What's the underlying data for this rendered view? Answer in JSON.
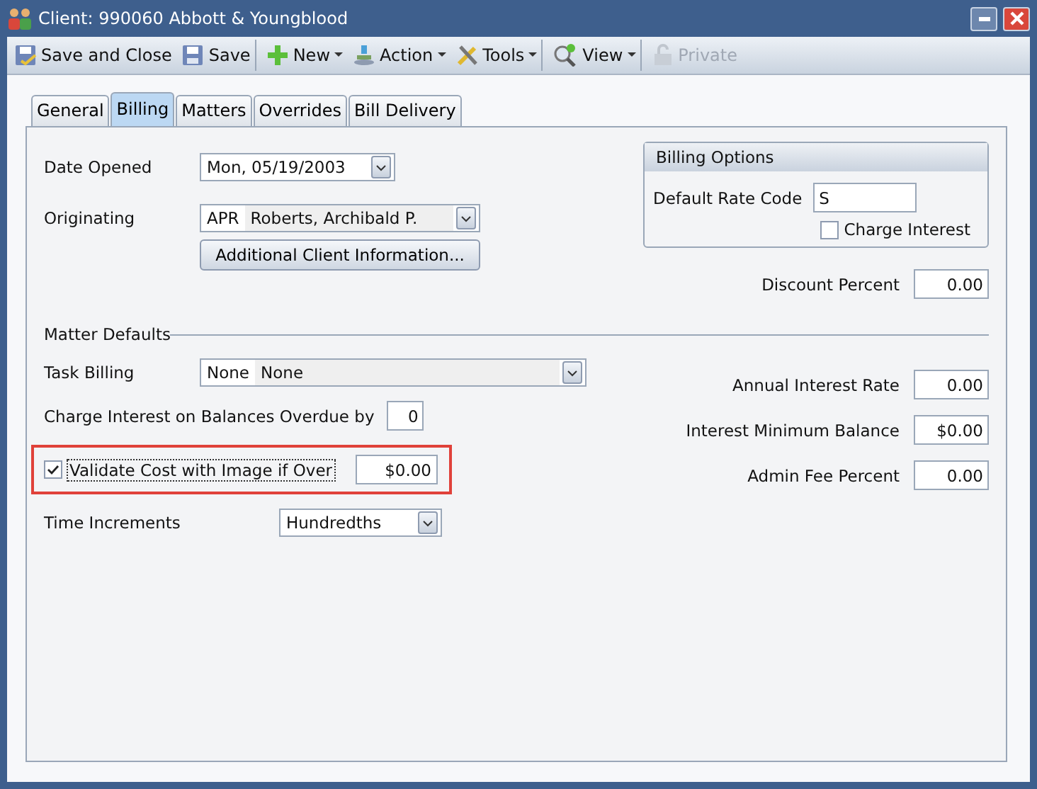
{
  "window": {
    "title": "Client: 990060 Abbott & Youngblood"
  },
  "toolbar": [
    {
      "label": "Save and Close",
      "dropdown": false,
      "disabled": false,
      "separator_after": false
    },
    {
      "label": "Save",
      "dropdown": false,
      "disabled": false,
      "separator_after": true
    },
    {
      "label": "New",
      "dropdown": true,
      "disabled": false,
      "separator_after": false
    },
    {
      "label": "Action",
      "dropdown": true,
      "disabled": false,
      "separator_after": false
    },
    {
      "label": "Tools",
      "dropdown": true,
      "disabled": false,
      "separator_after": true
    },
    {
      "label": "View",
      "dropdown": true,
      "disabled": false,
      "separator_after": true
    },
    {
      "label": "Private",
      "dropdown": false,
      "disabled": true,
      "separator_after": false
    }
  ],
  "tabs": [
    {
      "label": "General",
      "selected": false
    },
    {
      "label": "Billing",
      "selected": true
    },
    {
      "label": "Matters",
      "selected": false
    },
    {
      "label": "Overrides",
      "selected": false
    },
    {
      "label": "Bill Delivery",
      "selected": false
    }
  ],
  "date_opened": {
    "label": "Date Opened",
    "value": "Mon, 05/19/2003"
  },
  "originating": {
    "label": "Originating",
    "code": "APR",
    "name": "Roberts, Archibald P."
  },
  "additional_button": "Additional Client Information...",
  "billing_options": {
    "title": "Billing Options",
    "rate_code_label": "Default Rate Code",
    "rate_code": "S",
    "charge_interest": {
      "label": "Charge Interest",
      "checked": false
    }
  },
  "discount": {
    "label": "Discount Percent",
    "value": "0.00"
  },
  "matter_defaults": {
    "title": "Matter Defaults",
    "task_billing": {
      "label": "Task Billing",
      "code": "None",
      "name": "None"
    },
    "overdue": {
      "label": "Charge Interest on Balances Overdue by",
      "value": "0"
    },
    "validate": {
      "label": "Validate Cost with Image if Over",
      "checked": true,
      "value": "$0.00",
      "highlighted": true
    },
    "time_increments": {
      "label": "Time Increments",
      "value": "Hundredths"
    },
    "right_fields": [
      {
        "label": "Annual Interest Rate",
        "value": "0.00"
      },
      {
        "label": "Interest Minimum Balance",
        "value": "$0.00"
      },
      {
        "label": "Admin Fee Percent",
        "value": "0.00"
      }
    ]
  }
}
